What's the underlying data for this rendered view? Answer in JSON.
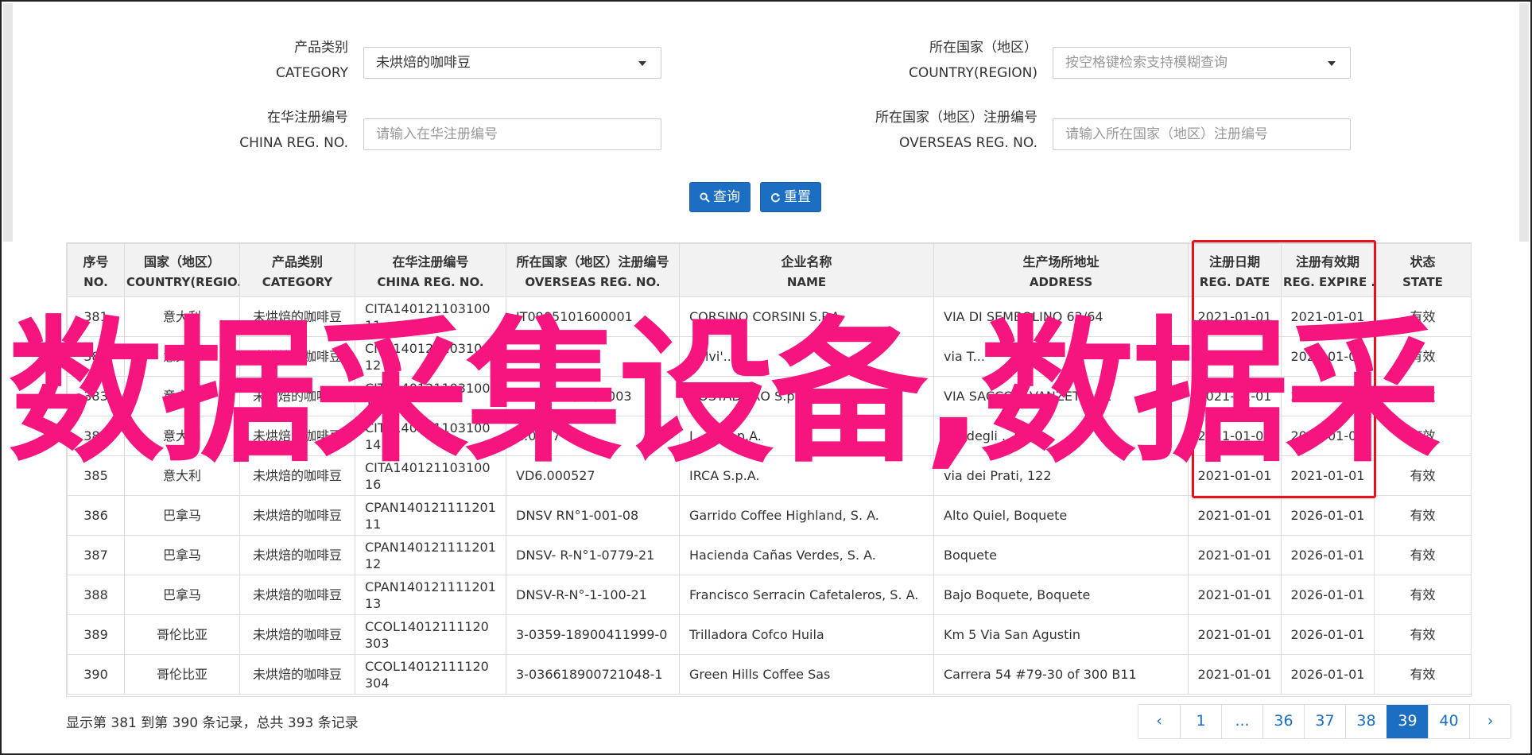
{
  "form": {
    "category": {
      "label_cn": "产品类别",
      "label_en": "CATEGORY",
      "value": "未烘焙的咖啡豆"
    },
    "country": {
      "label_cn": "所在国家（地区）",
      "label_en": "COUNTRY(REGION)",
      "placeholder": "按空格键检索支持模糊查询"
    },
    "china_reg": {
      "label_cn": "在华注册编号",
      "label_en": "CHINA REG. NO.",
      "placeholder": "请输入在华注册编号"
    },
    "overseas_reg": {
      "label_cn": "所在国家（地区）注册编号",
      "label_en": "OVERSEAS REG. NO.",
      "placeholder": "请输入所在国家（地区）注册编号"
    },
    "search_label": "查询",
    "reset_label": "重置"
  },
  "table": {
    "headers": [
      {
        "cn": "序号",
        "en": "NO."
      },
      {
        "cn": "国家（地区）",
        "en": "COUNTRY(REGIO..."
      },
      {
        "cn": "产品类别",
        "en": "CATEGORY"
      },
      {
        "cn": "在华注册编号",
        "en": "CHINA REG. NO."
      },
      {
        "cn": "所在国家（地区）注册编号",
        "en": "OVERSEAS REG. NO."
      },
      {
        "cn": "企业名称",
        "en": "NAME"
      },
      {
        "cn": "生产场所地址",
        "en": "ADDRESS"
      },
      {
        "cn": "注册日期",
        "en": "REG. DATE"
      },
      {
        "cn": "注册有效期",
        "en": "REG. EXPIRE ..."
      },
      {
        "cn": "状态",
        "en": "STATE"
      }
    ],
    "rows": [
      {
        "no": "381",
        "country": "意大利",
        "category": "未烘焙的咖啡豆",
        "china_reg": "CITA14012110310011",
        "overseas_reg": "IT0905101600001",
        "name": "CORSINO CORSINI S.P.A.",
        "address": "VIA DI SEMBOLINO 62/64",
        "reg_date": "2021-01-01",
        "expire": "2021-01-01",
        "state": "有效"
      },
      {
        "no": "382",
        "country": "意大利",
        "category": "未烘焙的咖啡豆",
        "china_reg": "CITA14012110310012",
        "overseas_reg": "IT09...00718",
        "name": "Salvi'...l",
        "address": "via T...",
        "reg_date": "2021-01-01",
        "expire": "2021-01-01",
        "state": "有效"
      },
      {
        "no": "383",
        "country": "意大利",
        "category": "未烘焙的咖啡豆",
        "china_reg": "CITA14012110310013",
        "overseas_reg": "N...0 - 09/07/2003",
        "name": "COSTADORO S.p.A.",
        "address": "VIA SACCO E VANZETTI 11",
        "reg_date": "2021-01-01",
        "expire": "2021-01-01",
        "state": "有效"
      },
      {
        "no": "384",
        "country": "意大利",
        "category": "未烘焙的咖啡豆",
        "china_reg": "CITA14012110310014",
        "overseas_reg": "...0597",
        "name": "I...oo S.p.A.",
        "address": "via degli ...ni, 5",
        "reg_date": "2021-01-01",
        "expire": "2021-01-01",
        "state": "有效"
      },
      {
        "no": "385",
        "country": "意大利",
        "category": "未烘焙的咖啡豆",
        "china_reg": "CITA14012110310016",
        "overseas_reg": "VD6.000527",
        "name": "IRCA S.p.A.",
        "address": "via dei Prati, 122",
        "reg_date": "2021-01-01",
        "expire": "2021-01-01",
        "state": "有效"
      },
      {
        "no": "386",
        "country": "巴拿马",
        "category": "未烘焙的咖啡豆",
        "china_reg": "CPAN14012111120111",
        "overseas_reg": "DNSV RN°1-001-08",
        "name": "Garrido Coffee Highland, S. A.",
        "address": "Alto Quiel, Boquete",
        "reg_date": "2021-01-01",
        "expire": "2026-01-01",
        "state": "有效"
      },
      {
        "no": "387",
        "country": "巴拿马",
        "category": "未烘焙的咖啡豆",
        "china_reg": "CPAN14012111120112",
        "overseas_reg": "DNSV- R-N°1-0779-21",
        "name": "Hacienda Cañas Verdes, S. A.",
        "address": "Boquete",
        "reg_date": "2021-01-01",
        "expire": "2026-01-01",
        "state": "有效"
      },
      {
        "no": "388",
        "country": "巴拿马",
        "category": "未烘焙的咖啡豆",
        "china_reg": "CPAN14012111120113",
        "overseas_reg": "DNSV-R-N°-1-100-21",
        "name": "Francisco Serracin Cafetaleros, S. A.",
        "address": "Bajo Boquete, Boquete",
        "reg_date": "2021-01-01",
        "expire": "2026-01-01",
        "state": "有效"
      },
      {
        "no": "389",
        "country": "哥伦比亚",
        "category": "未烘焙的咖啡豆",
        "china_reg": "CCOL14012111120303",
        "overseas_reg": "3-0359-18900411999-0",
        "name": "Trilladora Cofco Huila",
        "address": "Km 5 Via San Agustin",
        "reg_date": "2021-01-01",
        "expire": "2026-01-01",
        "state": "有效"
      },
      {
        "no": "390",
        "country": "哥伦比亚",
        "category": "未烘焙的咖啡豆",
        "china_reg": "CCOL14012111120304",
        "overseas_reg": "3-036618900721048-1",
        "name": "Green Hills Coffee Sas",
        "address": "Carrera 54 #79-30 of 300 B11",
        "reg_date": "2021-01-01",
        "expire": "2026-01-01",
        "state": "有效"
      }
    ]
  },
  "summary": "显示第 381 到第 390 条记录，总共 393 条记录",
  "pagination": {
    "prev": "‹",
    "pages": [
      "1",
      "...",
      "36",
      "37",
      "38",
      "39",
      "40"
    ],
    "active": "39",
    "next": "›"
  },
  "watermark": "数据采集设备,数据采"
}
